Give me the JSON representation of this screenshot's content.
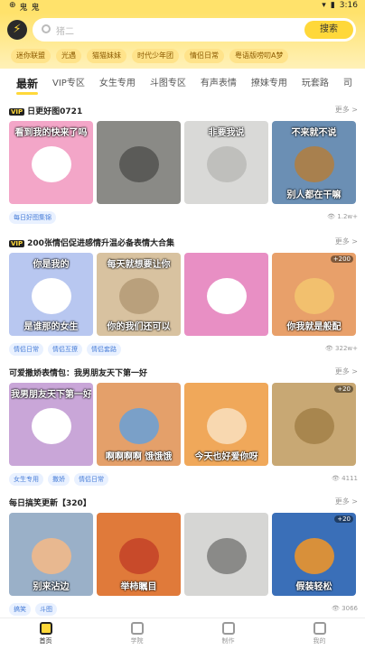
{
  "status": {
    "left_icons": [
      "⊕",
      "鬼",
      "鬼"
    ],
    "time": "3:16"
  },
  "search": {
    "placeholder": "猪二",
    "button": "搜索"
  },
  "chips": [
    "迷你联盟",
    "光遇",
    "猫猫妹妹",
    "时代少年团",
    "情侣日常",
    "粤语版唠叨A梦"
  ],
  "tabs": [
    "最新",
    "VIP专区",
    "女生专用",
    "斗图专区",
    "有声表情",
    "撩妹专用",
    "玩套路",
    "司"
  ],
  "sections": [
    {
      "title": "日更好图0721",
      "vip": true,
      "more": "更多 >",
      "tiles": [
        {
          "top": "看到我的快来了吗",
          "bottom": "",
          "badge": "",
          "bg": "#f3a6c8"
        },
        {
          "top": "",
          "bottom": "",
          "badge": "",
          "bg": "#8a8a86"
        },
        {
          "top": "非要我说",
          "bottom": "",
          "badge": "",
          "bg": "#d9d9d7"
        },
        {
          "top": "不来就不说",
          "bottom": "别人都在干嘛",
          "badge": "",
          "bg": "#6b8fb4"
        }
      ],
      "tags": [
        "每日好图集锦"
      ],
      "views": "1.2w+"
    },
    {
      "title": "200张情侣促进感情升温必备表情大合集",
      "vip": true,
      "more": "更多 >",
      "tiles": [
        {
          "top": "你是我的",
          "bottom": "是谁那的女生",
          "badge": "",
          "bg": "#b8c7f0"
        },
        {
          "top": "每天就想要让你",
          "bottom": "你的我们还可以",
          "badge": "",
          "bg": "#d8c2a0"
        },
        {
          "top": "",
          "bottom": "",
          "badge": "",
          "bg": "#e88fc4"
        },
        {
          "top": "",
          "bottom": "你我就是般配",
          "badge": "+200",
          "bg": "#e8a06a"
        }
      ],
      "tags": [
        "情侣日常",
        "情侣互撩",
        "情侣套路"
      ],
      "views": "322w+"
    },
    {
      "title": "可爱撒娇表情包：我男朋友天下第一好",
      "vip": false,
      "more": "更多 >",
      "tiles": [
        {
          "top": "我男朋友天下第一好",
          "bottom": "",
          "badge": "",
          "bg": "#c9a6d8"
        },
        {
          "top": "",
          "bottom": "啊啊啊啊 饿饿饿",
          "badge": "",
          "bg": "#e4a06a"
        },
        {
          "top": "",
          "bottom": "今天也好爱你呀",
          "badge": "",
          "bg": "#f0a85a"
        },
        {
          "top": "",
          "bottom": "",
          "badge": "+20",
          "bg": "#c8a874"
        }
      ],
      "tags": [
        "女生专用",
        "撒娇",
        "情侣日常"
      ],
      "views": "4111"
    },
    {
      "title": "每日搞笑更新【320】",
      "vip": false,
      "more": "更多 >",
      "tiles": [
        {
          "top": "",
          "bottom": "别来沾边",
          "badge": "",
          "bg": "#9ab0c8"
        },
        {
          "top": "",
          "bottom": "举柿瞩目",
          "badge": "",
          "bg": "#e07a3a"
        },
        {
          "top": "",
          "bottom": "",
          "badge": "",
          "bg": "#d6d6d4"
        },
        {
          "top": "",
          "bottom": "假装轻松",
          "badge": "+20",
          "bg": "#3a6fb8"
        }
      ],
      "tags": [
        "搞笑",
        "斗图"
      ],
      "views": "3066"
    }
  ],
  "nav": [
    "首页",
    "学院",
    "制作",
    "我的"
  ]
}
